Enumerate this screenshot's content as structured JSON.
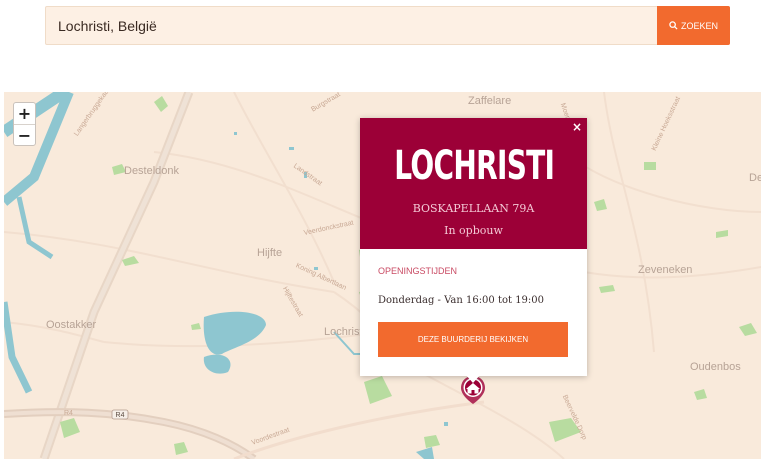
{
  "search": {
    "value": "Lochristi, België",
    "button_label": "ZOEKEN",
    "icon": "search-icon"
  },
  "map": {
    "zoom_in": "+",
    "zoom_out": "−",
    "places": [
      "Zaffelare",
      "Desteldonk",
      "Hijfte",
      "Oostakker",
      "Lochristi",
      "Zeveneken",
      "Oudenbos",
      "De"
    ],
    "streets": [
      "Burgstraat",
      "Langerbruggekaai",
      "Moerstraat",
      "Landstraat",
      "Veerdonckstraat",
      "Koning Albertlaan",
      "Hijftestraat",
      "Kleine Hoeksstraat",
      "R4",
      "Voordestraat",
      "Beervelde Dorp"
    ],
    "colors": {
      "land": "#f9eadb",
      "water": "#8ec6d0",
      "green": "#b8dca0",
      "roads": "#f1dccd"
    }
  },
  "popup": {
    "close": "×",
    "title": "LOCHRISTI",
    "address": "BOSKAPELLAAN 79A",
    "status": "In opbouw",
    "hours_label": "OPENINGSTIJDEN",
    "hours": "Donderdag - Van 16:00 tot 19:00",
    "cta": "DEZE BUURDERIJ BEKIJKEN",
    "colors": {
      "header": "#9c0037",
      "accent": "#f26a2e"
    }
  },
  "marker": {
    "icon": "barn-icon"
  }
}
